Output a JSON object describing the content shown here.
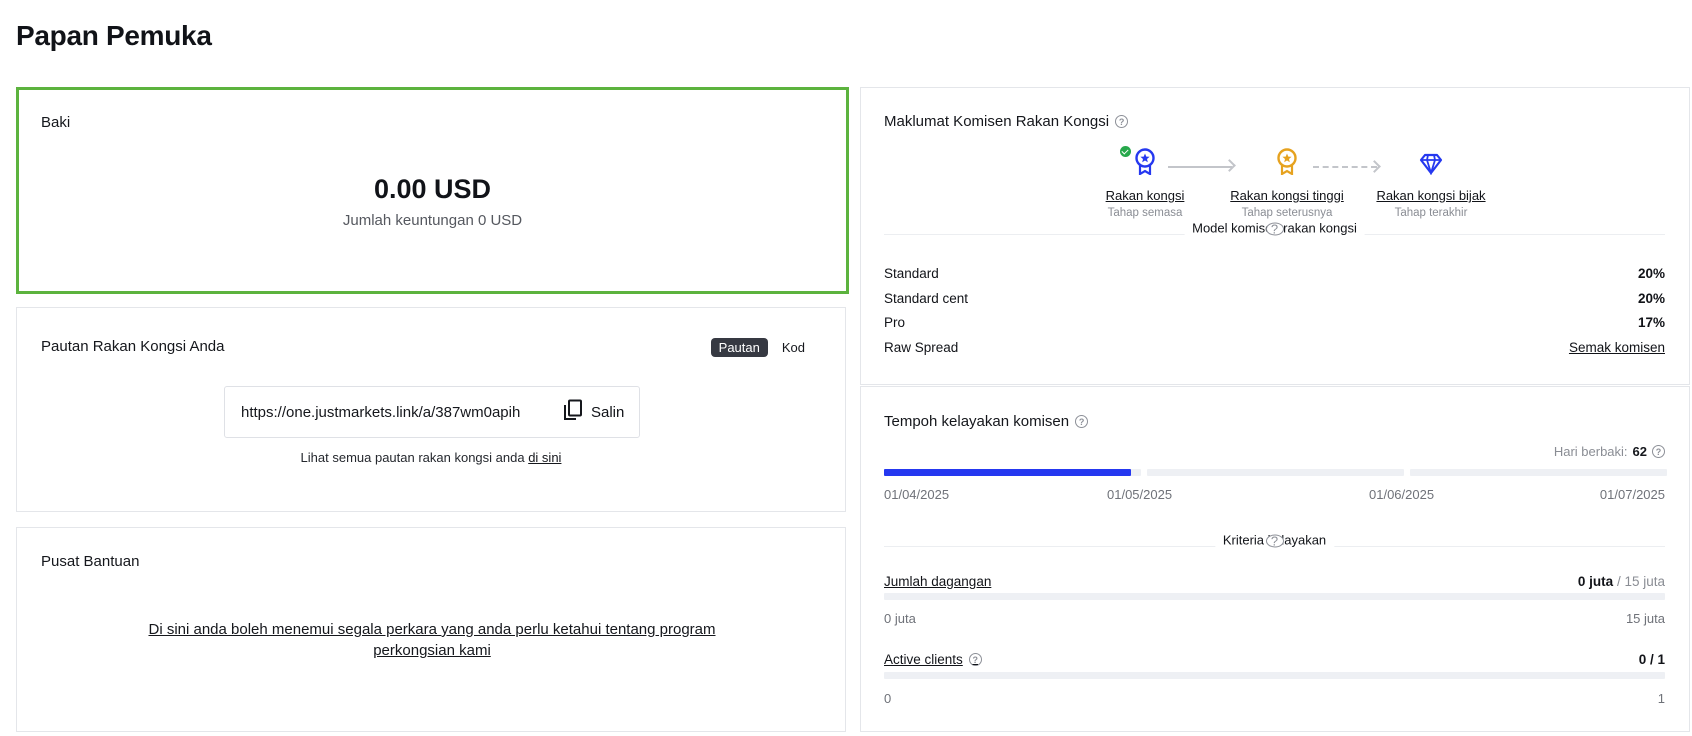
{
  "page": {
    "title": "Papan Pemuka"
  },
  "balance": {
    "title": "Baki",
    "amount": "0.00 USD",
    "subtitle": "Jumlah keuntungan 0 USD"
  },
  "partner_link": {
    "title": "Pautan Rakan Kongsi Anda",
    "toggle": {
      "link_label": "Pautan",
      "code_label": "Kod",
      "selected": "Pautan"
    },
    "url": "https://one.justmarkets.link/a/387wm0apih",
    "copy_label": "Salin",
    "note_prefix": "Lihat semua pautan rakan kongsi anda",
    "note_link": "di sini"
  },
  "help_center": {
    "title": "Pusat Bantuan",
    "link_text": "Di sini anda boleh menemui segala perkara yang anda perlu ketahui tentang program perkongsian kami"
  },
  "commission_info": {
    "title": "Maklumat Komisen Rakan Kongsi",
    "tiers": [
      {
        "name": "Rakan kongsi",
        "stage": "Tahap semasa",
        "icon": "medal-star-icon",
        "color": "#2538f0",
        "current": true
      },
      {
        "name": "Rakan kongsi tinggi",
        "stage": "Tahap seterusnya",
        "icon": "medal-star-icon",
        "color": "#e6a21f",
        "current": false
      },
      {
        "name": "Rakan kongsi bijak",
        "stage": "Tahap terakhir",
        "icon": "diamond-icon",
        "color": "#2538f0",
        "current": false
      }
    ],
    "model_label": "Model komisen rakan kongsi",
    "rates": [
      {
        "label": "Standard",
        "value": "20%"
      },
      {
        "label": "Standard cent",
        "value": "20%"
      },
      {
        "label": "Pro",
        "value": "17%"
      },
      {
        "label": "Raw Spread",
        "value": "Semak komisen"
      }
    ]
  },
  "qualification": {
    "title": "Tempoh kelayakan komisen",
    "days_left_label": "Hari berbaki:",
    "days_left": "62",
    "progress_fraction": 0.316,
    "dates": [
      "01/04/2025",
      "01/05/2025",
      "01/06/2025",
      "01/07/2025"
    ],
    "criteria_label": "Kriteria kelayakan",
    "criteria": [
      {
        "name": "Jumlah dagangan",
        "current": "0 juta",
        "target": "/ 15 juta",
        "min": "0 juta",
        "max": "15 juta",
        "fraction": 0,
        "has_help": false
      },
      {
        "name": "Active clients",
        "current": "0 / 1",
        "target": "",
        "min": "0",
        "max": "1",
        "fraction": 0,
        "has_help": true
      }
    ]
  },
  "colors": {
    "accent": "#2538f0",
    "balance_border": "#5cb33e",
    "gold": "#e6a21f",
    "success": "#27a84b"
  }
}
